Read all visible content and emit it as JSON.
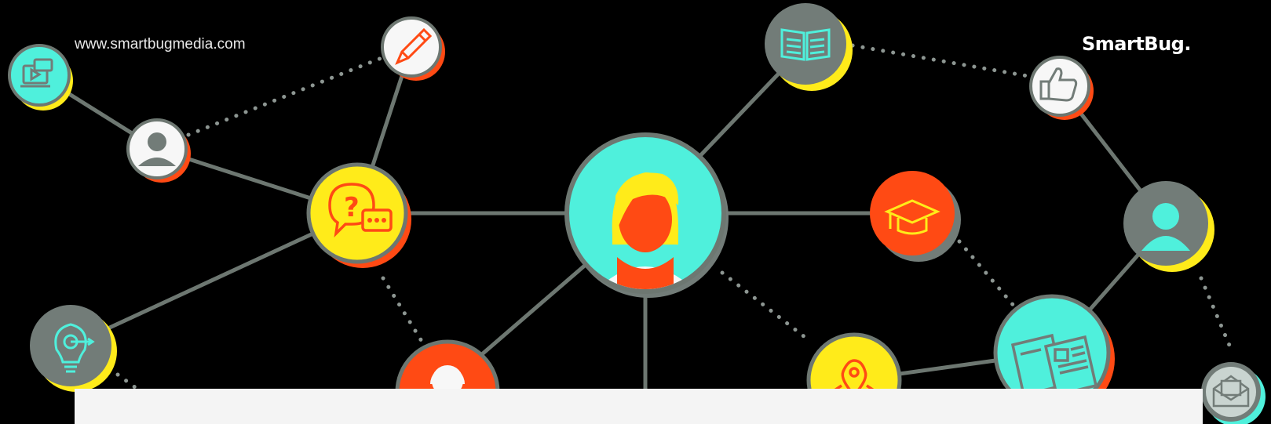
{
  "header": {
    "url": "www.smartbugmedia.com",
    "brand": "SmartBug."
  },
  "colors": {
    "background": "#000000",
    "line": "#6d7771",
    "cyan": "#4ff0dc",
    "yellow": "#ffeb1a",
    "orange": "#ff4a14",
    "gray": "#727c78",
    "white": "#f7f7f7",
    "panel": "#f4f4f4"
  },
  "nodes": [
    {
      "id": "video-icon",
      "fill": "cyan",
      "accent": "yellow",
      "icon": "video-chat"
    },
    {
      "id": "pencil-icon",
      "fill": "white",
      "accent": "orange",
      "icon": "pencil"
    },
    {
      "id": "person-small-icon",
      "fill": "white",
      "accent": "orange",
      "icon": "person"
    },
    {
      "id": "question-chat-icon",
      "fill": "yellow",
      "accent": "orange",
      "icon": "question-chat"
    },
    {
      "id": "lightbulb-target-icon",
      "fill": "gray",
      "accent": "yellow",
      "icon": "lightbulb-target"
    },
    {
      "id": "person-orange-icon",
      "fill": "orange",
      "accent": "gray",
      "icon": "person"
    },
    {
      "id": "woman-avatar-icon",
      "fill": "cyan",
      "accent": "gray",
      "icon": "woman"
    },
    {
      "id": "book-icon",
      "fill": "gray",
      "accent": "yellow",
      "icon": "open-book"
    },
    {
      "id": "graduation-cap-icon",
      "fill": "orange",
      "accent": "gray",
      "icon": "graduation-cap"
    },
    {
      "id": "location-pin-icon",
      "fill": "yellow",
      "accent": "gray",
      "icon": "location-pin"
    },
    {
      "id": "thumbs-up-icon",
      "fill": "white",
      "accent": "orange",
      "icon": "thumbs-up"
    },
    {
      "id": "person-gray-icon",
      "fill": "gray",
      "accent": "yellow",
      "icon": "person"
    },
    {
      "id": "documents-icon",
      "fill": "cyan",
      "accent": "orange",
      "icon": "documents"
    },
    {
      "id": "envelope-icon",
      "fill": "gray",
      "accent": "cyan",
      "icon": "envelope"
    }
  ]
}
